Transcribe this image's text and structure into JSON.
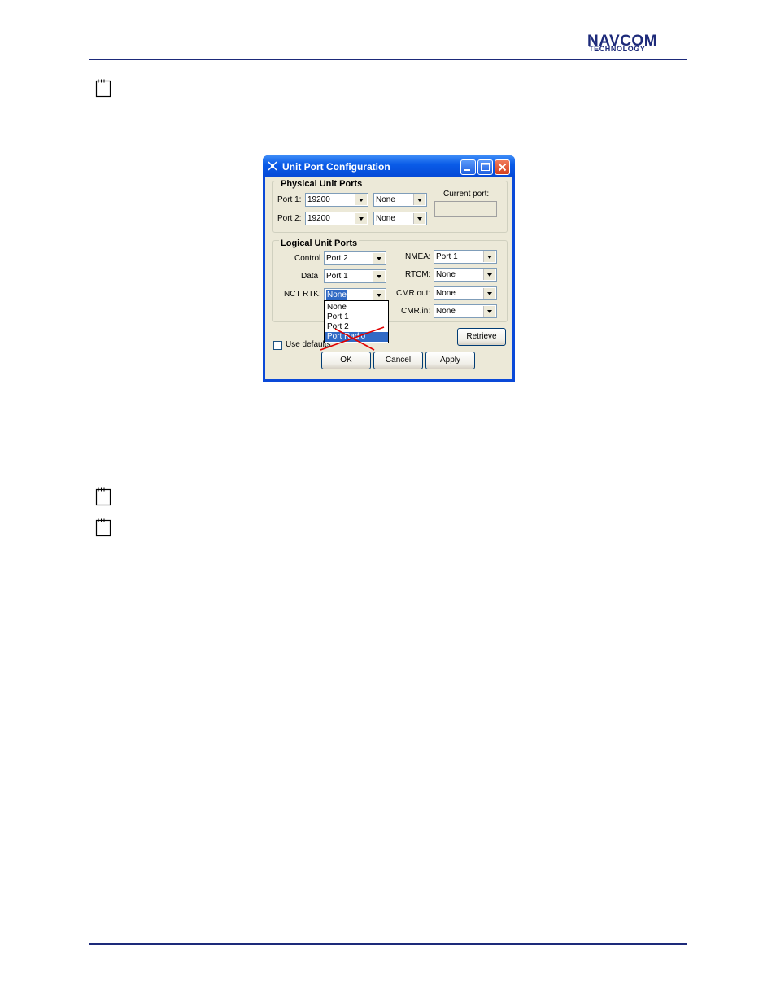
{
  "header": {
    "logo_main": "NAVCOM",
    "logo_sub": "TECHNOLOGY"
  },
  "notes": [
    {
      "icon": "note-icon"
    },
    {
      "icon": "note-icon"
    },
    {
      "icon": "note-icon"
    }
  ],
  "dialog": {
    "title": "Unit Port Configuration",
    "physical": {
      "group_label": "Physical  Unit Ports",
      "port1_label": "Port 1:",
      "port1_baud": "19200",
      "port1_mode": "None",
      "port2_label": "Port 2:",
      "port2_baud": "19200",
      "port2_mode": "None",
      "current_port_label": "Current port:",
      "current_port_value": ""
    },
    "logical": {
      "group_label": "Logical Unit Ports",
      "control_label": "Control",
      "control_value": "Port 2",
      "data_label": "Data",
      "data_value": "Port 1",
      "ncrtk_label": "NCT RTK:",
      "ncrtk_value": "None",
      "nmea_label": "NMEA:",
      "nmea_value": "Port 1",
      "rtcm_label": "RTCM:",
      "rtcm_value": "None",
      "cmrout_label": "CMR.out:",
      "cmrout_value": "None",
      "cmrin_label": "CMR.in:",
      "cmrin_value": "None"
    },
    "dropdown_options": [
      "None",
      "Port 1",
      "Port 2",
      "Port Radio"
    ],
    "dropdown_highlight_index": 3,
    "use_defaults_label": "Use defaults",
    "use_defaults_checked": false,
    "retrieve_label": "Retrieve",
    "ok_label": "OK",
    "cancel_label": "Cancel",
    "apply_label": "Apply"
  },
  "colors": {
    "brand_navy": "#1d2a7a",
    "title_blue": "#0a5ce8",
    "dialog_face": "#ece9d8",
    "selection": "#316ac5",
    "annotation_red": "#e00000"
  }
}
